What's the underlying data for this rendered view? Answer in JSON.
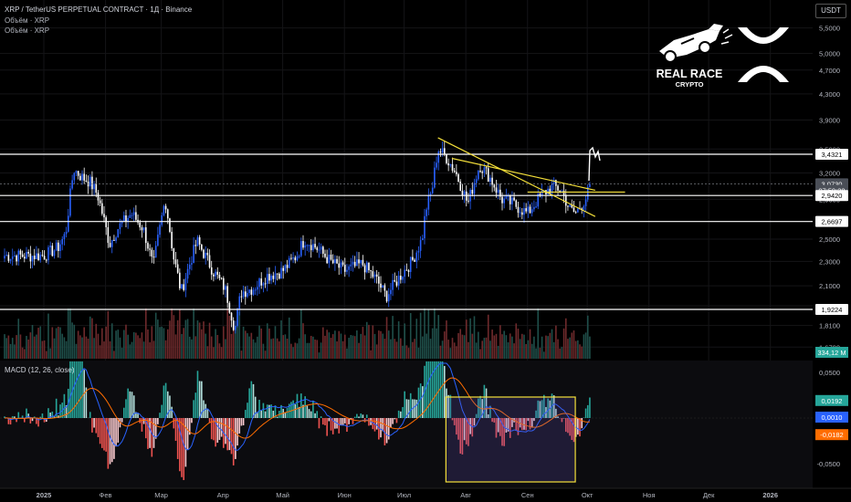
{
  "header": {
    "title": "XRP / TetherUS PERPETUAL CONTRACT · 1Д · Binance",
    "volume_label_1": "Объём · XRP",
    "volume_label_2": "Объём · XRP"
  },
  "currency_badge": "USDT",
  "logo": {
    "brand_line1": "REAL RACE",
    "brand_line2": "CRYPTO",
    "symbol_icon": "xrp-x-logo",
    "car_icon": "race-car-logo"
  },
  "price_axis": {
    "ticks": [
      "5,5000",
      "5,0000",
      "4,7000",
      "4,3000",
      "3,9000",
      "3,5000",
      "3,2000",
      "2,9000",
      "2,5000",
      "2,3000",
      "2,1000",
      "1,9500",
      "1,8100",
      "1,6700"
    ],
    "labels": [
      {
        "text": "3,4321",
        "price": 3.4321,
        "style": "level"
      },
      {
        "text": "3,0730",
        "price": 3.073,
        "style": "current"
      },
      {
        "text": "07:59:28",
        "price": 3.0,
        "style": "timer"
      },
      {
        "text": "2,9420",
        "price": 2.942,
        "style": "level"
      },
      {
        "text": "2,6697",
        "price": 2.6697,
        "style": "level"
      },
      {
        "text": "1,9224",
        "price": 1.9224,
        "style": "level"
      }
    ]
  },
  "volume_badge": {
    "text": "334,12 M",
    "color": "#26a69a"
  },
  "macd": {
    "title": "MACD (12, 26, close)",
    "ticks": [
      "0,0500",
      "-0,0500"
    ],
    "labels": [
      {
        "text": "0,0192",
        "value": 0.0192,
        "color": "#26a69a"
      },
      {
        "text": "0,0010",
        "value": 0.001,
        "color": "#2962ff"
      },
      {
        "text": "-0,0182",
        "value": -0.0182,
        "color": "#ff6d00"
      }
    ]
  },
  "time_axis": [
    "2025",
    "Фев",
    "Мар",
    "Апр",
    "Май",
    "Июн",
    "Июл",
    "Авг",
    "Сен",
    "Окт",
    "Ноя",
    "Дек",
    "2026"
  ],
  "colors": {
    "up": "#2962ff",
    "down": "#ffffff",
    "level_line": "#ffffff",
    "trendline": "#f5e03a",
    "hist_pos": "#26a69a",
    "hist_neg": "#ef5350",
    "macd_line": "#2962ff",
    "signal_line": "#ff6d00",
    "box": "#f5e03a"
  },
  "chart_data": {
    "type": "candlestick",
    "symbol": "XRP / TetherUS PERPETUAL CONTRACT",
    "interval": "1Д",
    "exchange": "Binance",
    "price_scale": "log",
    "horizontal_levels": [
      3.4321,
      2.942,
      2.6697,
      1.9224
    ],
    "current_price": 3.073,
    "close_path": [
      {
        "x": "2025-01-01",
        "y": 2.35
      },
      {
        "x": "2025-01-08",
        "y": 2.42
      },
      {
        "x": "2025-01-12",
        "y": 2.55
      },
      {
        "x": "2025-01-16",
        "y": 3.25
      },
      {
        "x": "2025-01-20",
        "y": 3.15
      },
      {
        "x": "2025-01-24",
        "y": 3.1
      },
      {
        "x": "2025-01-28",
        "y": 2.95
      },
      {
        "x": "2025-02-03",
        "y": 2.45
      },
      {
        "x": "2025-02-07",
        "y": 2.6
      },
      {
        "x": "2025-02-14",
        "y": 2.75
      },
      {
        "x": "2025-02-20",
        "y": 2.6
      },
      {
        "x": "2025-02-25",
        "y": 2.25
      },
      {
        "x": "2025-03-03",
        "y": 2.9
      },
      {
        "x": "2025-03-07",
        "y": 2.35
      },
      {
        "x": "2025-03-11",
        "y": 2.05
      },
      {
        "x": "2025-03-19",
        "y": 2.48
      },
      {
        "x": "2025-03-27",
        "y": 2.22
      },
      {
        "x": "2025-04-02",
        "y": 2.08
      },
      {
        "x": "2025-04-07",
        "y": 1.78
      },
      {
        "x": "2025-04-10",
        "y": 2.05
      },
      {
        "x": "2025-04-16",
        "y": 2.08
      },
      {
        "x": "2025-04-23",
        "y": 2.18
      },
      {
        "x": "2025-05-01",
        "y": 2.22
      },
      {
        "x": "2025-05-08",
        "y": 2.35
      },
      {
        "x": "2025-05-12",
        "y": 2.5
      },
      {
        "x": "2025-05-18",
        "y": 2.42
      },
      {
        "x": "2025-05-25",
        "y": 2.3
      },
      {
        "x": "2025-06-01",
        "y": 2.22
      },
      {
        "x": "2025-06-10",
        "y": 2.28
      },
      {
        "x": "2025-06-17",
        "y": 2.15
      },
      {
        "x": "2025-06-22",
        "y": 2.02
      },
      {
        "x": "2025-06-30",
        "y": 2.2
      },
      {
        "x": "2025-07-05",
        "y": 2.3
      },
      {
        "x": "2025-07-10",
        "y": 2.5
      },
      {
        "x": "2025-07-12",
        "y": 2.8
      },
      {
        "x": "2025-07-15",
        "y": 3.0
      },
      {
        "x": "2025-07-18",
        "y": 3.5
      },
      {
        "x": "2025-07-22",
        "y": 3.4
      },
      {
        "x": "2025-07-27",
        "y": 3.2
      },
      {
        "x": "2025-08-02",
        "y": 2.85
      },
      {
        "x": "2025-08-08",
        "y": 3.3
      },
      {
        "x": "2025-08-13",
        "y": 3.15
      },
      {
        "x": "2025-08-19",
        "y": 2.9
      },
      {
        "x": "2025-08-25",
        "y": 2.85
      },
      {
        "x": "2025-09-01",
        "y": 2.75
      },
      {
        "x": "2025-09-08",
        "y": 2.95
      },
      {
        "x": "2025-09-14",
        "y": 3.05
      },
      {
        "x": "2025-09-18",
        "y": 3.0
      },
      {
        "x": "2025-09-22",
        "y": 2.8
      },
      {
        "x": "2025-09-25",
        "y": 2.75
      },
      {
        "x": "2025-09-30",
        "y": 2.9
      },
      {
        "x": "2025-10-03",
        "y": 3.073
      }
    ],
    "trendlines": [
      {
        "from": {
          "x": "2025-07-18",
          "y": 3.65
        },
        "to": {
          "x": "2025-10-05",
          "y": 2.72
        }
      },
      {
        "from": {
          "x": "2025-07-25",
          "y": 3.38
        },
        "to": {
          "x": "2025-10-05",
          "y": 3.0
        }
      },
      {
        "from": {
          "x": "2025-09-01",
          "y": 2.98
        },
        "to": {
          "x": "2025-10-20",
          "y": 2.98
        }
      }
    ],
    "macd": {
      "macd": 0.001,
      "signal": -0.0182,
      "histogram": 0.0192
    },
    "volume_last": "334,12 M"
  }
}
